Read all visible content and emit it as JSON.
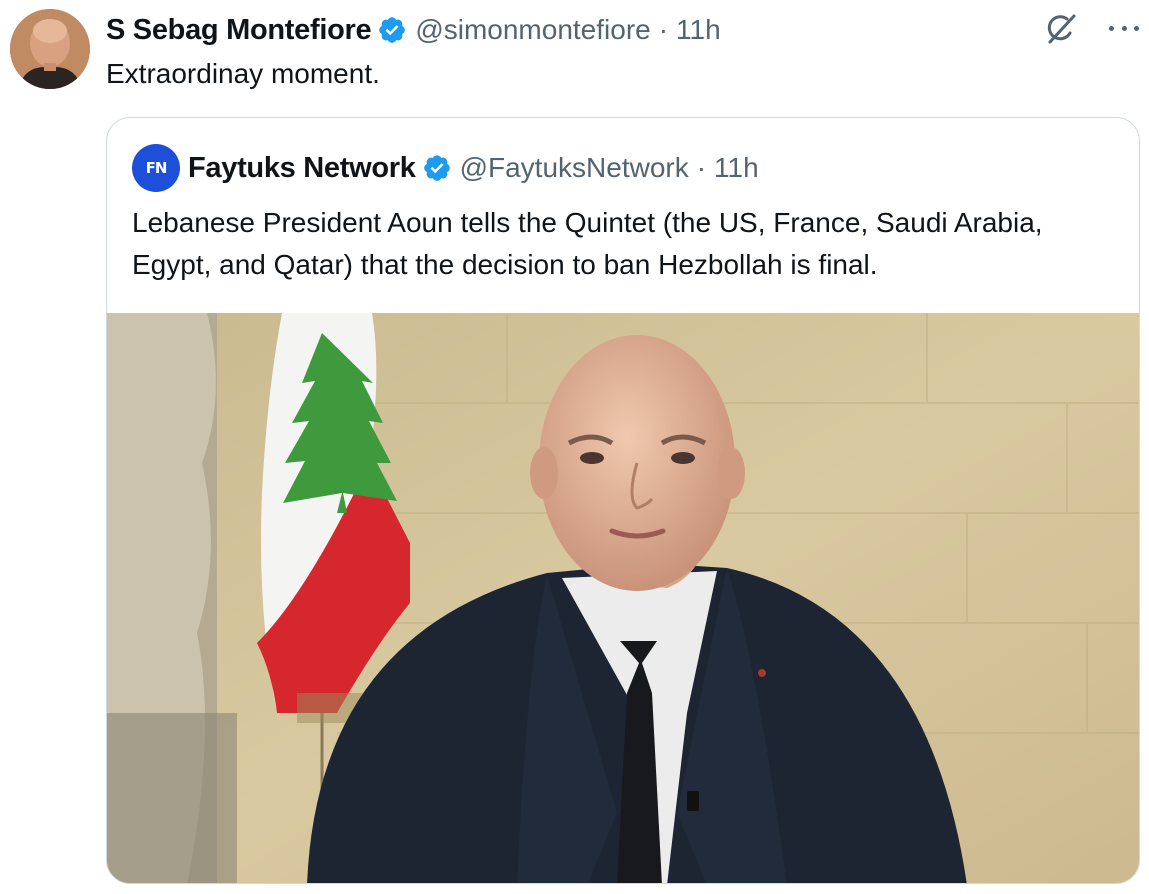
{
  "tweet": {
    "author_name": "S Sebag Montefiore",
    "handle": "@simonmontefiore",
    "separator": "·",
    "time": "11h",
    "text": "Extraordinay moment."
  },
  "quoted_tweet": {
    "author_name": "Faytuks Network",
    "avatar_text": "FN",
    "handle": "@FaytuksNetwork",
    "separator": "·",
    "time": "11h",
    "text": "Lebanese President Aoun tells the Quintet (the US, France, Saudi Arabia, Egypt, and Qatar) that the decision to ban Hezbollah is final."
  },
  "icons": {
    "verified": "verified-badge-icon",
    "grok": "grok-icon",
    "more": "more-options-icon"
  },
  "colors": {
    "verified_blue": "#1d9bf0",
    "secondary_text": "#536471",
    "border": "#cfd9de"
  }
}
